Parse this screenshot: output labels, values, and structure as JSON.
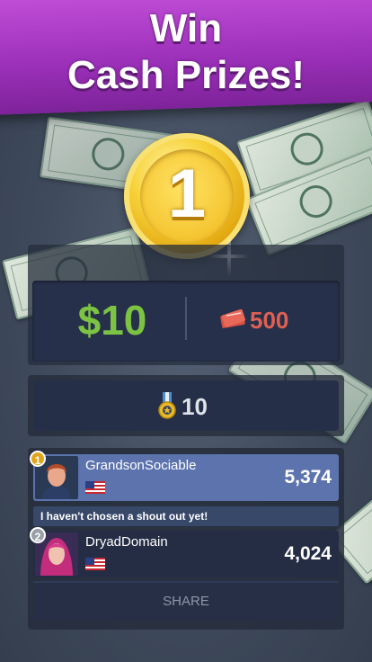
{
  "banner": {
    "line1": "Win",
    "line2": "Cash Prizes!"
  },
  "coin": {
    "rank": "1"
  },
  "prize": {
    "amount": "$10",
    "tickets": "500"
  },
  "rank": {
    "value": "10"
  },
  "leaderboard": {
    "rows": [
      {
        "position": "1",
        "name": "GrandsonSociable",
        "score": "5,374",
        "flag": "us-flag-icon"
      },
      {
        "position": "2",
        "name": "DryadDomain",
        "score": "4,024",
        "flag": "us-flag-icon"
      }
    ],
    "shout_out": "I haven't chosen a shout out yet!"
  },
  "share_label": "SHARE",
  "colors": {
    "banner": "#a63bc4",
    "prize": "#7cc243",
    "tickets": "#e06052",
    "highlight_row": "#5c73ad"
  }
}
